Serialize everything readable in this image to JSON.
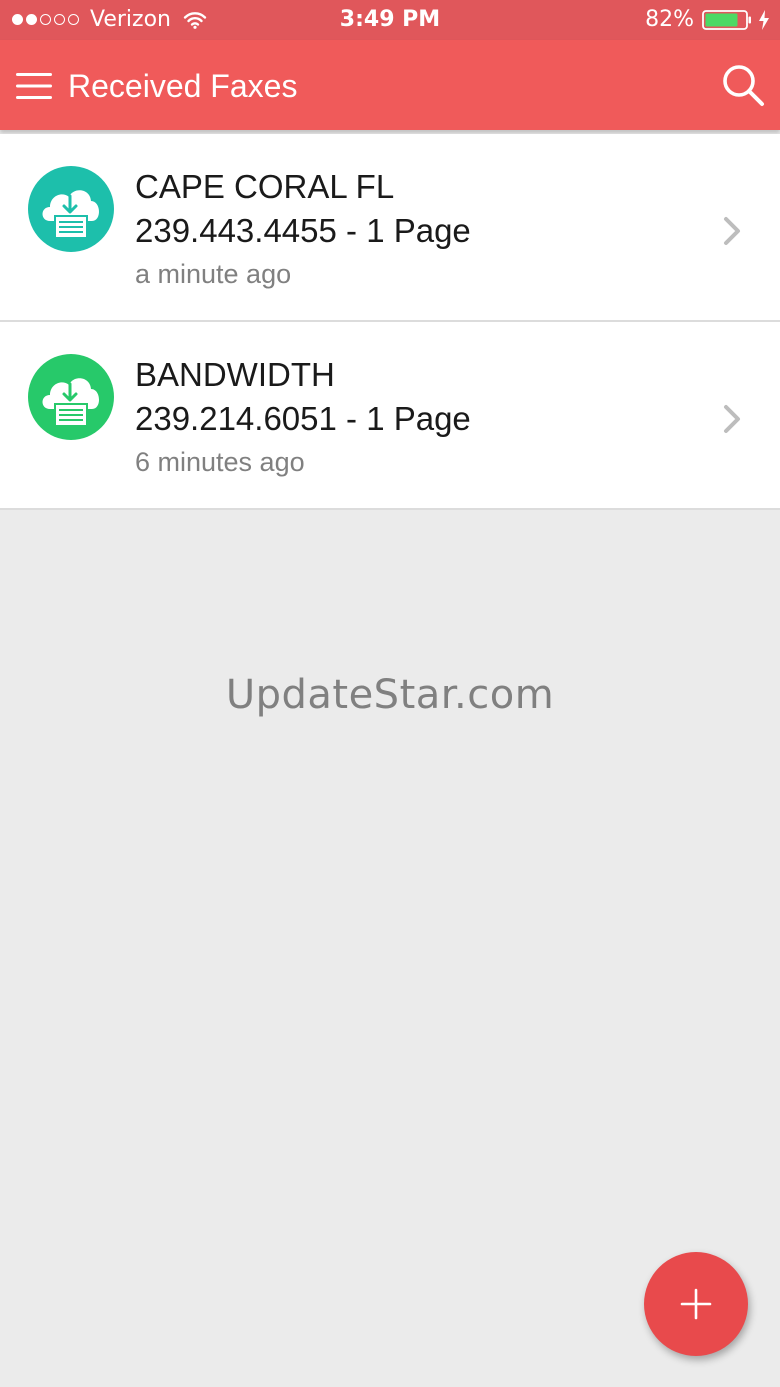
{
  "status_bar": {
    "carrier": "Verizon",
    "time": "3:49 PM",
    "battery_percent": "82%",
    "battery_level": 0.82,
    "signal_bars_filled": 2,
    "signal_bars_total": 5
  },
  "app_bar": {
    "title": "Received Faxes",
    "menu_icon": "hamburger-menu-icon",
    "search_icon": "search-icon"
  },
  "faxes": [
    {
      "name": "CAPE CORAL FL",
      "detail": "239.443.4455 - 1 Page",
      "time": "a minute ago",
      "icon": "cloud-download-fax-icon",
      "icon_color": "#1dbfab"
    },
    {
      "name": "BANDWIDTH",
      "detail": "239.214.6051 - 1 Page",
      "time": "6 minutes ago",
      "icon": "cloud-download-fax-icon",
      "icon_color": "#27c96a"
    }
  ],
  "watermark": "UpdateStar.com",
  "fab": {
    "icon": "plus-icon",
    "color": "#e84a4c"
  },
  "colors": {
    "status_bar": "#e0575b",
    "app_bar": "#f05a5a",
    "background": "#ebebeb"
  }
}
